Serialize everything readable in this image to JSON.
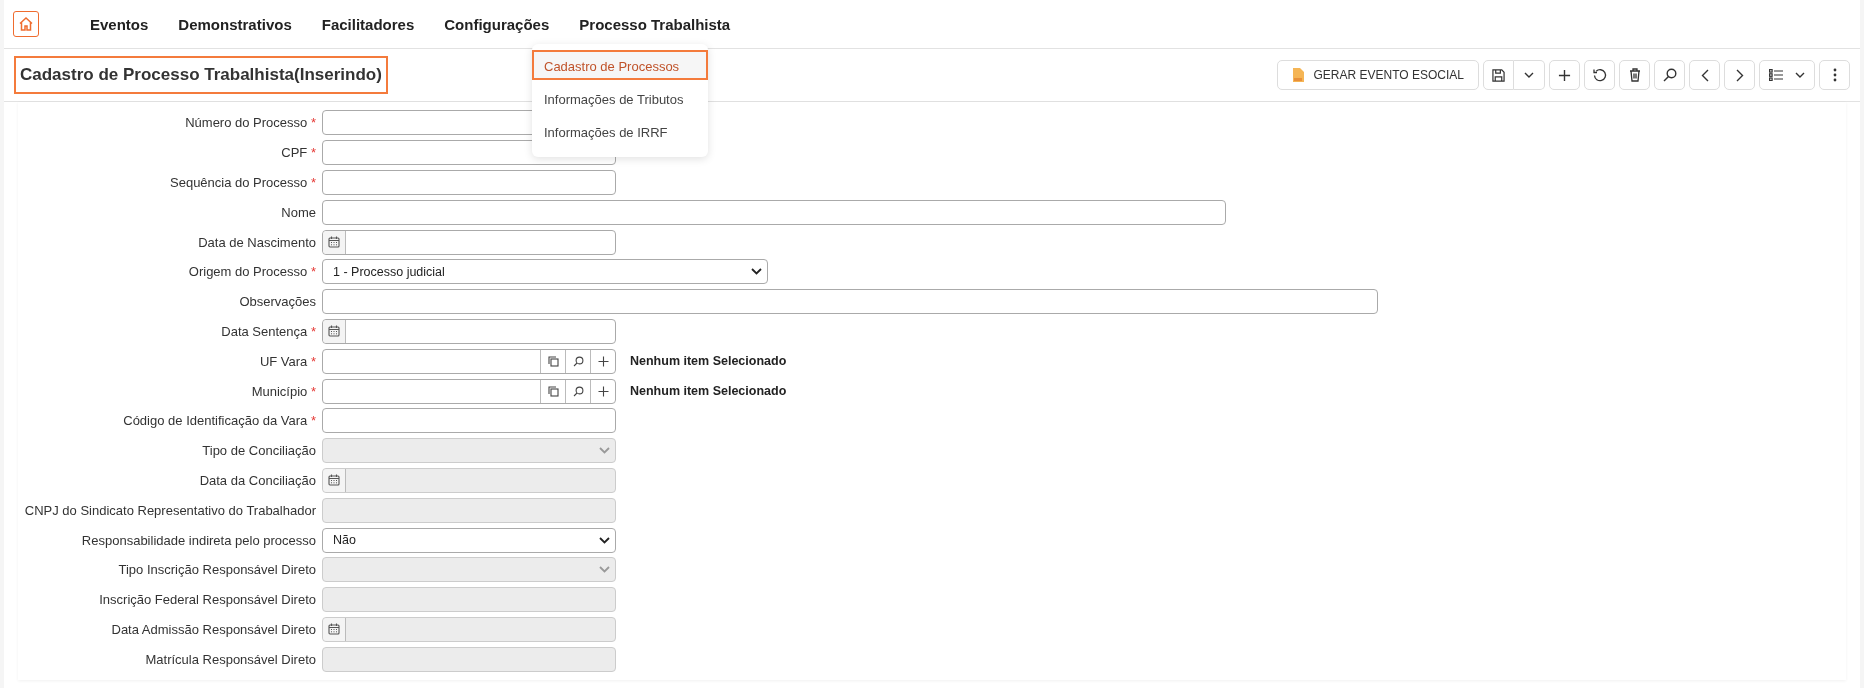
{
  "nav": {
    "items": [
      {
        "label": "Eventos"
      },
      {
        "label": "Demonstrativos"
      },
      {
        "label": "Facilitadores"
      },
      {
        "label": "Configurações"
      },
      {
        "label": "Processo Trabalhista"
      }
    ]
  },
  "dropdown": {
    "items": [
      {
        "label": "Cadastro de Processos",
        "selected": true
      },
      {
        "label": "Informações de Tributos",
        "selected": false
      },
      {
        "label": "Informações de IRRF",
        "selected": false
      }
    ]
  },
  "page": {
    "title": "Cadastro de Processo Trabalhista(Inserindo)",
    "highlighted": true
  },
  "toolbar": {
    "esocial_button": "GERAR EVENTO ESOCIAL"
  },
  "form": {
    "fields": [
      {
        "label": "Número do Processo",
        "required_mark": "*",
        "kind": "text",
        "disabled": false
      },
      {
        "label": "CPF",
        "required_mark": "*",
        "kind": "text",
        "disabled": false
      },
      {
        "label": "Sequência do Processo",
        "required_mark": "*",
        "kind": "text",
        "disabled": false
      },
      {
        "label": "Nome",
        "kind": "text",
        "disabled": false
      },
      {
        "label": "Data de Nascimento",
        "kind": "date",
        "disabled": false
      },
      {
        "label": "Origem do Processo",
        "required_mark": "*",
        "kind": "select",
        "disabled": false,
        "value": "1 - Processo judicial"
      },
      {
        "label": "Observações",
        "kind": "text",
        "disabled": false
      },
      {
        "label": "Data Sentença",
        "required_mark": "*",
        "kind": "date",
        "disabled": false
      },
      {
        "label": "UF Vara",
        "required_mark": "*",
        "kind": "lookup",
        "disabled": false,
        "note": "Nenhum item Selecionado"
      },
      {
        "label": "Município",
        "required_mark": "*",
        "kind": "lookup",
        "disabled": false,
        "note": "Nenhum item Selecionado"
      },
      {
        "label": "Código de Identificação da Vara",
        "required_mark": "*",
        "kind": "text",
        "disabled": false
      },
      {
        "label": "Tipo de Conciliação",
        "kind": "select",
        "disabled": true
      },
      {
        "label": "Data da Conciliação",
        "kind": "date",
        "disabled": true
      },
      {
        "label": "CNPJ do Sindicato Representativo do Trabalhador",
        "kind": "text",
        "disabled": true
      },
      {
        "label": "Responsabilidade indireta pelo processo",
        "kind": "select",
        "disabled": false,
        "value": "Não"
      },
      {
        "label": "Tipo Inscrição Responsável Direto",
        "kind": "select",
        "disabled": true
      },
      {
        "label": "Inscrição Federal Responsável Direto",
        "kind": "text",
        "disabled": true
      },
      {
        "label": "Data Admissão Responsável Direto",
        "kind": "date",
        "disabled": true
      },
      {
        "label": "Matrícula Responsável Direto",
        "kind": "text",
        "disabled": true
      }
    ]
  }
}
